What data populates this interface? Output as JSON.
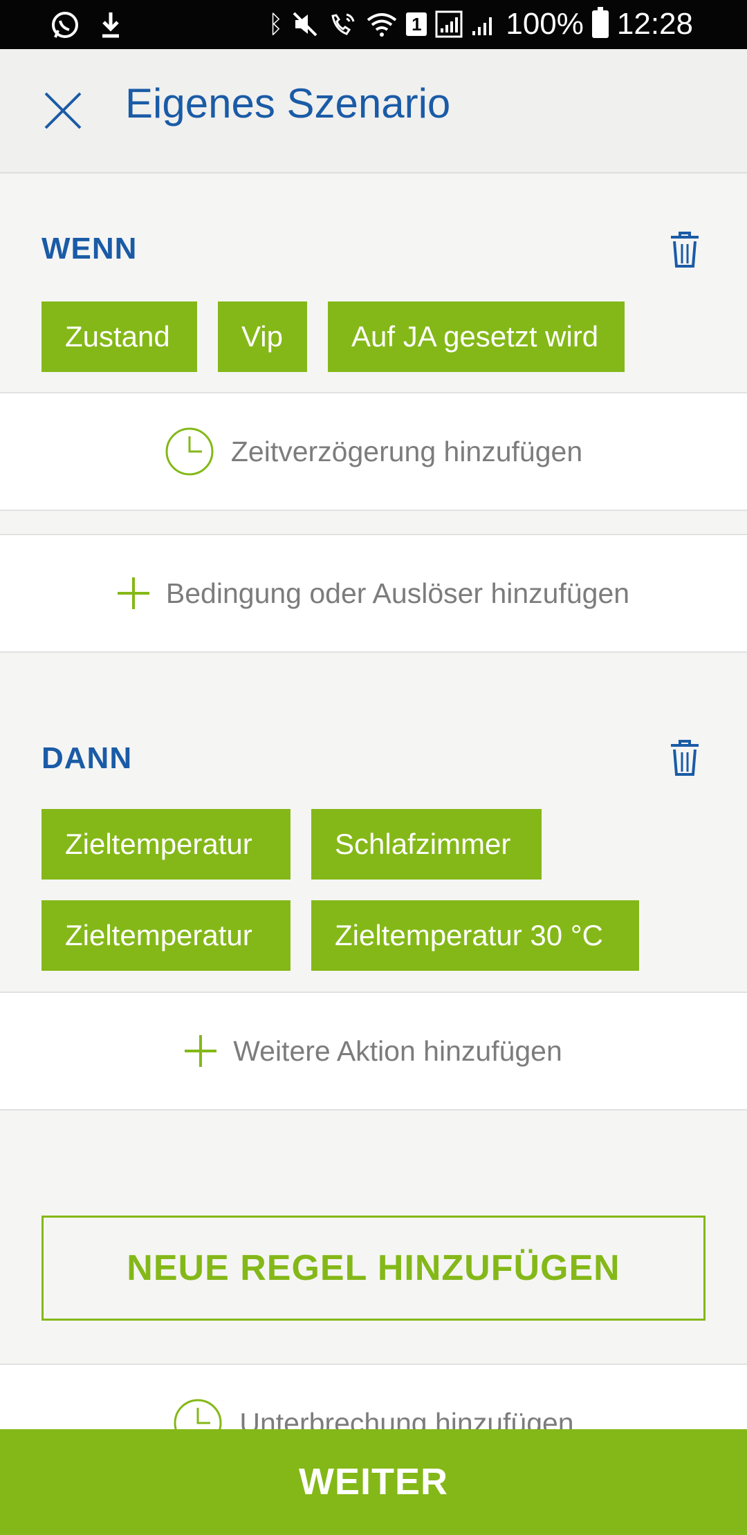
{
  "status_bar": {
    "battery": "100%",
    "time": "12:28",
    "sim_badge": "1"
  },
  "header": {
    "title": "Eigenes Szenario"
  },
  "wenn": {
    "heading": "WENN",
    "chips": [
      "Zustand",
      "Vip",
      "Auf JA gesetzt wird"
    ],
    "delay_label": "Zeitverzögerung hinzufügen",
    "add_condition_label": "Bedingung oder Auslöser hinzufügen"
  },
  "dann": {
    "heading": "DANN",
    "chips": [
      "Zieltemperatur",
      "Schlafzimmer",
      "Zieltemperatur",
      "Zieltemperatur 30 °C"
    ],
    "add_action_label": "Weitere Aktion hinzufügen"
  },
  "new_rule_label": "NEUE REGEL HINZUFÜGEN",
  "interrupt_label": "Unterbrechung hinzufügen",
  "continue_label": "WEITER",
  "colors": {
    "accent_green": "#84b818",
    "title_blue": "#1a5ba6"
  },
  "icons": [
    "whatsapp-icon",
    "download-icon",
    "bluetooth-icon",
    "mute-icon",
    "wifi-call-icon",
    "wifi-icon",
    "signal-icon",
    "battery-icon",
    "close-icon",
    "trash-icon",
    "clock-icon",
    "plus-icon"
  ]
}
